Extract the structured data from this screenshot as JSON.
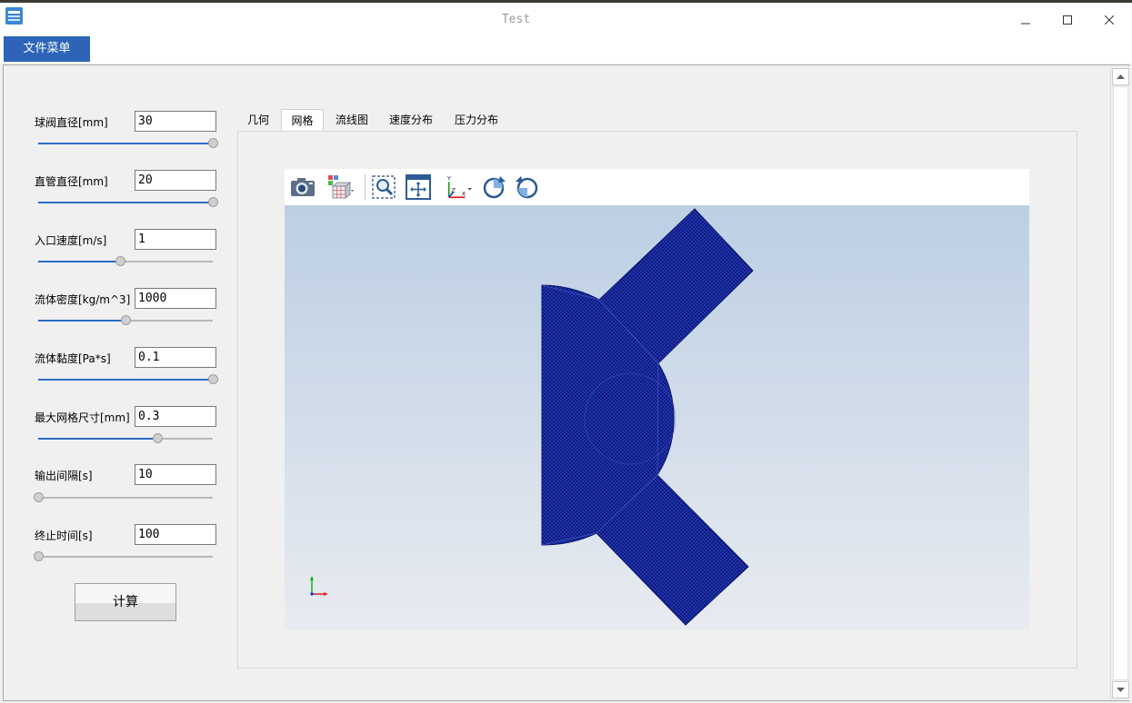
{
  "window": {
    "title": "Test"
  },
  "menu": {
    "file_label": "文件菜单"
  },
  "params": [
    {
      "label": "球阀直径[mm]",
      "value": "30",
      "slider": 1.0
    },
    {
      "label": "直管直径[mm]",
      "value": "20",
      "slider": 1.0
    },
    {
      "label": "入口速度[m/s]",
      "value": "1",
      "slider": 0.47
    },
    {
      "label": "流体密度[kg/m^3]",
      "value": "1000",
      "slider": 0.5
    },
    {
      "label": "流体黏度[Pa*s]",
      "value": "0.1",
      "slider": 1.0
    },
    {
      "label": "最大网格尺寸[mm]",
      "value": "0.3",
      "slider": 0.68
    },
    {
      "label": "输出间隔[s]",
      "value": "10",
      "slider": 0.0
    },
    {
      "label": "终止时间[s]",
      "value": "100",
      "slider": 0.0
    }
  ],
  "calc_label": "计算",
  "tabs": [
    "几何",
    "网格",
    "流线图",
    "速度分布",
    "压力分布"
  ],
  "active_tab": "网格",
  "toolbar_icons": [
    "camera-icon",
    "view-cube-icon",
    "zoom-box-icon",
    "fit-view-icon",
    "axes-orientation-icon",
    "rotate-cw-icon",
    "rotate-ccw-icon"
  ],
  "colors": {
    "accent": "#2d64b8",
    "mesh": "#0d1a8a",
    "slider": "#2b6cc4"
  }
}
